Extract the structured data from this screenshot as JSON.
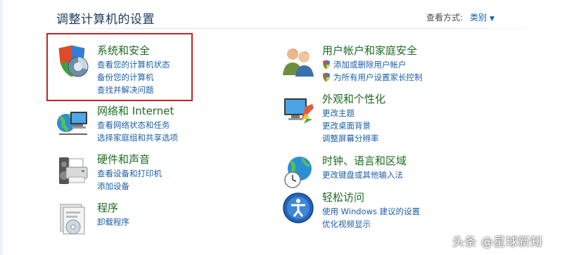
{
  "page": {
    "title": "调整计算机的设置",
    "view_by_label": "查看方式:",
    "view_by_value": "类别"
  },
  "categories": [
    {
      "title": "系统和安全",
      "links": [
        "查看您的计算机状态",
        "备份您的计算机",
        "查找并解决问题"
      ],
      "icon": "shield-chart-icon"
    },
    {
      "title": "网络和 Internet",
      "links": [
        "查看网络状态和任务",
        "选择家庭组和共享选项"
      ],
      "icon": "network-globe-icon"
    },
    {
      "title": "硬件和声音",
      "links": [
        "查看设备和打印机",
        "添加设备"
      ],
      "icon": "printer-speaker-icon"
    },
    {
      "title": "程序",
      "links": [
        "卸载程序"
      ],
      "icon": "programs-icon"
    },
    {
      "title": "用户帐户和家庭安全",
      "links": [
        "添加或删除用户帐户",
        "为所有用户设置家长控制"
      ],
      "icon": "users-icon"
    },
    {
      "title": "外观和个性化",
      "links": [
        "更改主题",
        "更改桌面背景",
        "调整屏幕分辨率"
      ],
      "icon": "appearance-icon"
    },
    {
      "title": "时钟、语言和区域",
      "links": [
        "更改键盘或其他输入法"
      ],
      "icon": "clock-globe-icon"
    },
    {
      "title": "轻松访问",
      "links": [
        "使用 Windows 建议的设置",
        "优化视频显示"
      ],
      "icon": "ease-of-access-icon"
    }
  ],
  "watermark": "头条 @星球新知",
  "colors": {
    "title_green": "#1e6b22",
    "link_blue": "#1d5fa8",
    "highlight_red": "#c4222a"
  }
}
